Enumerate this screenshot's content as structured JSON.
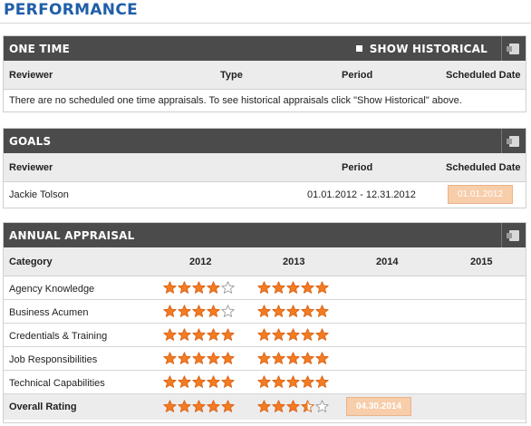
{
  "page": {
    "title": "PERFORMANCE"
  },
  "one_time": {
    "header": "ONE TIME",
    "show_historical": "SHOW HISTORICAL",
    "columns": {
      "reviewer": "Reviewer",
      "type": "Type",
      "period": "Period",
      "scheduled": "Scheduled Date"
    },
    "empty_message": "There are no scheduled one time appraisals. To see historical appraisals click \"Show Historical\" above."
  },
  "goals": {
    "header": "GOALS",
    "columns": {
      "reviewer": "Reviewer",
      "period": "Period",
      "scheduled": "Scheduled Date"
    },
    "rows": [
      {
        "reviewer": "Jackie Tolson",
        "period": "01.01.2012 - 12.31.2012",
        "scheduled": "01.01.2012"
      }
    ]
  },
  "annual": {
    "header": "ANNUAL APPRAISAL",
    "columns": {
      "category": "Category",
      "y2012": "2012",
      "y2013": "2013",
      "y2014": "2014",
      "y2015": "2015"
    },
    "rows": [
      {
        "category": "Agency Knowledge",
        "r2012": 4,
        "r2013": 5
      },
      {
        "category": "Business Acumen",
        "r2012": 4,
        "r2013": 5
      },
      {
        "category": "Credentials & Training",
        "r2012": 5,
        "r2013": 5
      },
      {
        "category": "Job Responsibilities",
        "r2012": 5,
        "r2013": 5
      },
      {
        "category": "Technical Capabilities",
        "r2012": 5,
        "r2013": 5
      }
    ],
    "overall": {
      "label": "Overall Rating",
      "r2012": 5,
      "r2013": 3.5,
      "date_2014": "04.30.2014"
    },
    "max_stars": 5
  },
  "colors": {
    "star_fill": "#f47b20",
    "star_empty": "#9a9a9a",
    "header_bg": "#4b4b4b",
    "title": "#1f5ea8",
    "date_button": "#f7cdaa"
  },
  "icons": {
    "export": "excel-export-icon",
    "star": "star-icon",
    "historical": "checkbox-icon"
  }
}
